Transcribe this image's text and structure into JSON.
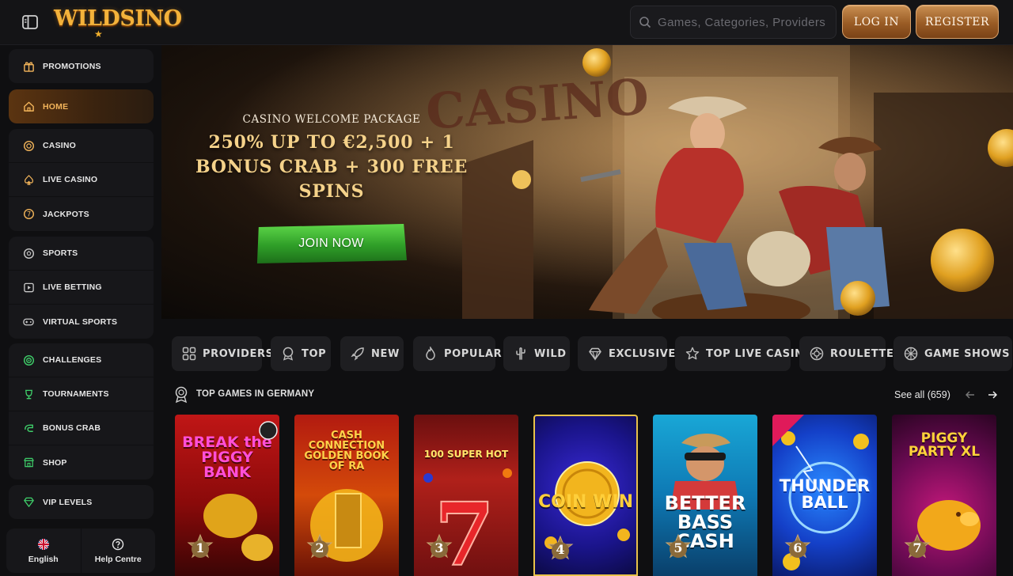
{
  "header": {
    "logo_text": "WILDSINO",
    "search_placeholder": "Games, Categories, Providers",
    "login_label": "LOG IN",
    "register_label": "REGISTER"
  },
  "sidebar": {
    "groups": [
      [
        {
          "label": "PROMOTIONS",
          "icon": "gift-icon"
        }
      ],
      [
        {
          "label": "HOME",
          "icon": "home-icon",
          "active": true
        }
      ],
      [
        {
          "label": "CASINO",
          "icon": "chip-icon"
        },
        {
          "label": "LIVE CASINO",
          "icon": "spade-icon"
        },
        {
          "label": "JACKPOTS",
          "icon": "jackpot-icon"
        }
      ],
      [
        {
          "label": "SPORTS",
          "icon": "ball-icon"
        },
        {
          "label": "LIVE BETTING",
          "icon": "play-icon"
        },
        {
          "label": "VIRTUAL SPORTS",
          "icon": "gamepad-icon"
        }
      ],
      [
        {
          "label": "CHALLENGES",
          "icon": "target-icon"
        },
        {
          "label": "TOURNAMENTS",
          "icon": "trophy-icon"
        },
        {
          "label": "BONUS CRAB",
          "icon": "crab-icon"
        },
        {
          "label": "SHOP",
          "icon": "shop-icon"
        }
      ],
      [
        {
          "label": "VIP LEVELS",
          "icon": "diamond-icon"
        }
      ]
    ],
    "language_label": "English",
    "help_label": "Help Centre"
  },
  "hero": {
    "subtitle": "CASINO WELCOME PACKAGE",
    "title": "250% UP TO €2,500 + 1 BONUS CRAB + 300 FREE SPINS",
    "cta_label": "JOIN NOW"
  },
  "categories": [
    {
      "label": "PROVIDERS",
      "icon": "grid-icon"
    },
    {
      "label": "TOP",
      "icon": "medal-icon"
    },
    {
      "label": "NEW",
      "icon": "rocket-icon"
    },
    {
      "label": "POPULAR",
      "icon": "flame-icon"
    },
    {
      "label": "WILD",
      "icon": "cactus-icon"
    },
    {
      "label": "EXCLUSIVE",
      "icon": "diamond-icon"
    },
    {
      "label": "TOP LIVE CASINO",
      "icon": "star-icon"
    },
    {
      "label": "ROULETTE",
      "icon": "roulette-icon"
    },
    {
      "label": "GAME SHOWS",
      "icon": "wheel-icon"
    }
  ],
  "top_games": {
    "title": "TOP GAMES IN GERMANY",
    "see_all": "See all (659)",
    "games": [
      {
        "name": "BREAK the PIGGY BANK",
        "rank": "1"
      },
      {
        "name": "CASH CONNECTION GOLDEN BOOK OF RA",
        "rank": "2"
      },
      {
        "name": "100 SUPER HOT",
        "rank": "3"
      },
      {
        "name": "COIN WIN",
        "rank": "4"
      },
      {
        "name": "BETTER BASS CASH",
        "rank": "5"
      },
      {
        "name": "THUNDER BALL",
        "rank": "6"
      },
      {
        "name": "PIGGY PARTY XL",
        "rank": "7"
      }
    ]
  },
  "colors": {
    "accent_gold": "#f2b45a",
    "cta_green": "#2f9e28",
    "background": "#0f0f11"
  }
}
